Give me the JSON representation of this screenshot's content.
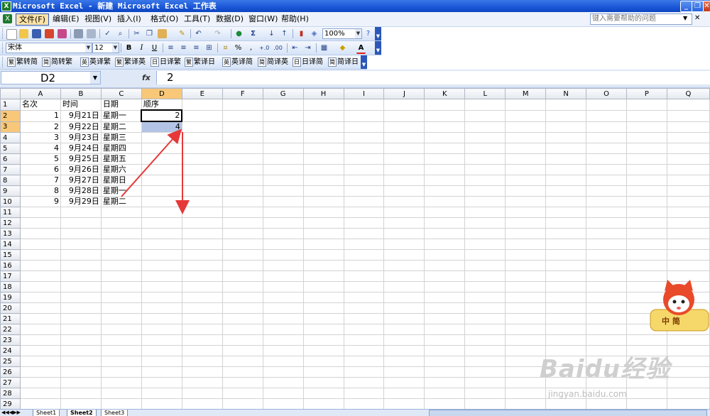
{
  "window": {
    "title": "Microsoft Excel - 新建 Microsoft Excel 工作表",
    "app_icon": "excel-icon"
  },
  "menu": {
    "items": [
      "文件(F)",
      "编辑(E)",
      "视图(V)",
      "插入(I)",
      "格式(O)",
      "工具(T)",
      "数据(D)",
      "窗口(W)",
      "帮助(H)"
    ],
    "help_placeholder": "键入需要帮助的问题"
  },
  "standard_toolbar": {
    "zoom": "100%"
  },
  "format_toolbar": {
    "font": "宋体",
    "size": "12",
    "bold": "B",
    "italic": "I",
    "underline": "U",
    "percent": "%",
    "comma": ",",
    "font_color": "A"
  },
  "convert_toolbar": {
    "buttons": [
      {
        "icon": "繁",
        "label": "繁转简"
      },
      {
        "icon": "简",
        "label": "简转繁"
      },
      {
        "icon": "英",
        "label": "英译繁"
      },
      {
        "icon": "繁",
        "label": "繁译英"
      },
      {
        "icon": "日",
        "label": "日译繁"
      },
      {
        "icon": "繁",
        "label": "繁译日"
      },
      {
        "icon": "英",
        "label": "英译简"
      },
      {
        "icon": "简",
        "label": "简译英"
      },
      {
        "icon": "日",
        "label": "日译简"
      },
      {
        "icon": "简",
        "label": "简译日"
      }
    ]
  },
  "formula_bar": {
    "name_box": "D2",
    "fx": "fx",
    "value": "2"
  },
  "sheet": {
    "columns": [
      "A",
      "B",
      "C",
      "D",
      "E",
      "F",
      "G",
      "H",
      "I",
      "J",
      "K",
      "L",
      "M",
      "N",
      "O",
      "P",
      "Q"
    ],
    "rows": [
      [
        "名次",
        "时间",
        "日期",
        "顺序"
      ],
      [
        "1",
        "9月21日",
        "星期一",
        "2"
      ],
      [
        "2",
        "9月22日",
        "星期二",
        "4"
      ],
      [
        "3",
        "9月23日",
        "星期三",
        ""
      ],
      [
        "4",
        "9月24日",
        "星期四",
        ""
      ],
      [
        "5",
        "9月25日",
        "星期五",
        ""
      ],
      [
        "6",
        "9月26日",
        "星期六",
        ""
      ],
      [
        "7",
        "9月27日",
        "星期日",
        ""
      ],
      [
        "8",
        "9月28日",
        "星期一",
        ""
      ],
      [
        "9",
        "9月29日",
        "星期二",
        ""
      ]
    ],
    "row_count": 29,
    "active_cell": "D2",
    "selected_range": "D2:D3"
  },
  "sheet_tabs": [
    "Sheet1",
    "Sheet2",
    "Sheet3"
  ],
  "overlays": {
    "arrow_color": "#e63838",
    "mascot_badge": "中 简",
    "watermark": "Baidu经验",
    "watermark_sub": "jingyan.baidu.com"
  }
}
